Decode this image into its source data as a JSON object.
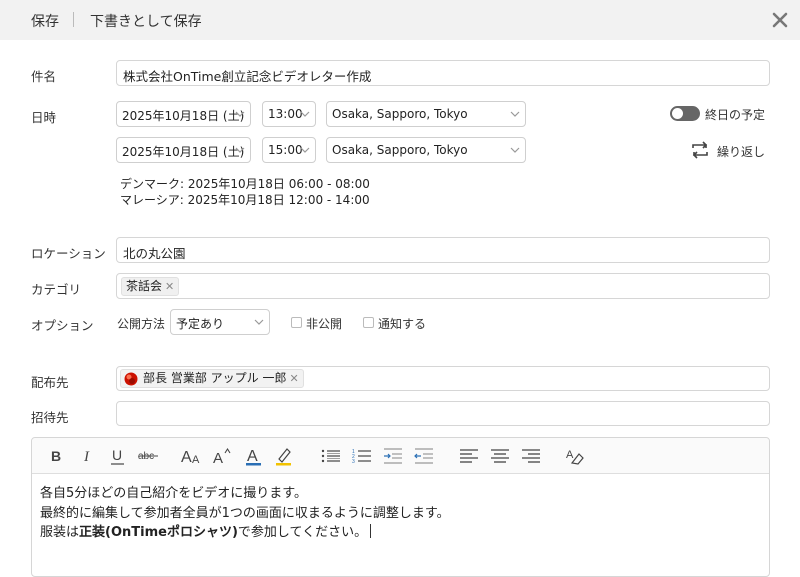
{
  "topbar": {
    "save_label": "保存",
    "draft_label": "下書きとして保存"
  },
  "subject": {
    "label": "件名",
    "value": "株式会社OnTime創立記念ビデオレター作成"
  },
  "datetime": {
    "label": "日時",
    "start_date": "2025年10月18日 (土)",
    "start_time": "13:00",
    "start_tz": "Osaka, Sapporo, Tokyo",
    "end_date": "2025年10月18日 (土)",
    "end_time": "15:00",
    "end_tz": "Osaka, Sapporo, Tokyo",
    "allday_label": "終日の予定",
    "allday_on": false,
    "repeat_label": "繰り返し",
    "tz_lines": [
      "デンマーク: 2025年10月18日 06:00  -  08:00",
      "マレーシア: 2025年10月18日 12:00  -  14:00"
    ]
  },
  "location": {
    "label": "ロケーション",
    "value": "北の丸公園"
  },
  "category": {
    "label": "カテゴリ",
    "chips": [
      "茶話会"
    ]
  },
  "options": {
    "label": "オプション",
    "publish_label": "公開方法",
    "publish_value": "予定あり",
    "private_label": "非公開",
    "notify_label": "通知する"
  },
  "distribution": {
    "label": "配布先",
    "chips": [
      "部長 営業部 アップル 一郎"
    ]
  },
  "invitees": {
    "label": "招待先",
    "value": ""
  },
  "editor": {
    "line1": "各自5分ほどの自己紹介をビデオに撮ります。",
    "line2": "最終的に編集して参加者全員が1つの画面に収まるように調整します。",
    "line3_pre": "服装は",
    "line3_bold": "正装(OnTimeポロシャツ)",
    "line3_post": "で参加してください。"
  },
  "colors": {
    "topbar_bg": "#f2f2f2",
    "toggle_off": "#666666",
    "border": "#d6d6d6",
    "avatar_red": "#cc1100"
  }
}
